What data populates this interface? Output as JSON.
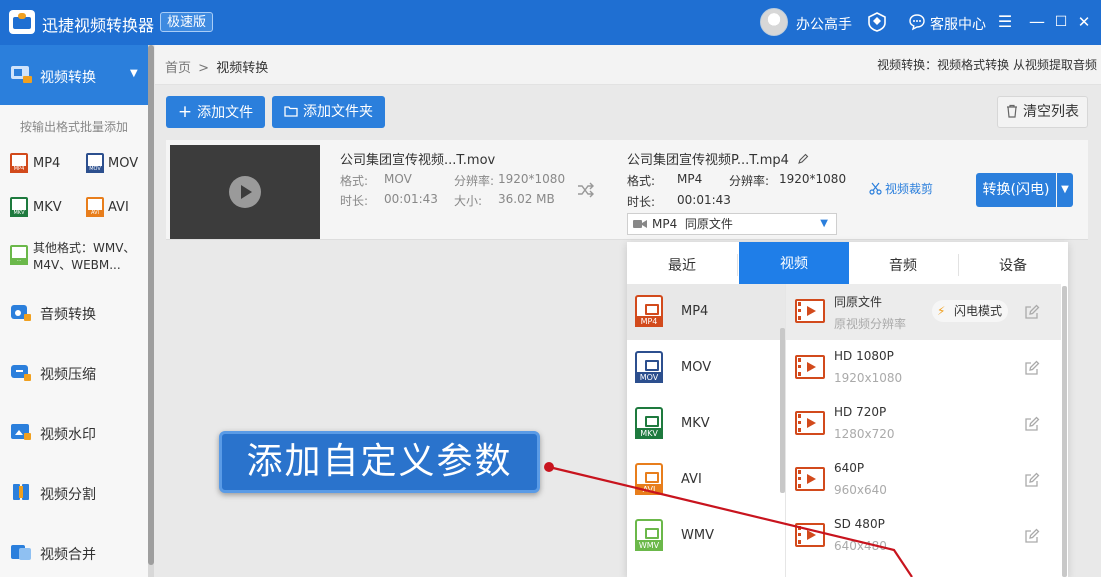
{
  "titlebar": {
    "app_title": "迅捷视频转换器",
    "edition_badge": "极速版",
    "user_name": "办公高手",
    "service_label": "客服中心",
    "menu_glyph": "☰",
    "minimize_glyph": "—",
    "maximize_glyph": "☐",
    "close_glyph": "✕"
  },
  "sidebar": {
    "active_item": "视频转换",
    "batch_hint": "按输出格式批量添加",
    "formats": [
      {
        "label": "MP4",
        "color": "#d24a1c"
      },
      {
        "label": "MOV",
        "color": "#2c4f8e"
      },
      {
        "label": "MKV",
        "color": "#1e7a3e"
      },
      {
        "label": "AVI",
        "color": "#e87e1c"
      }
    ],
    "other_formats_line1": "其他格式：WMV、",
    "other_formats_line2": "M4V、WEBM...",
    "items": [
      {
        "label": "音频转换"
      },
      {
        "label": "视频压缩"
      },
      {
        "label": "视频水印"
      },
      {
        "label": "视频分割"
      },
      {
        "label": "视频合并"
      }
    ]
  },
  "breadcrumb": {
    "home": "首页",
    "separator": ">",
    "current": "视频转换",
    "right_info": "视频转换：视频格式转换 从视频提取音频"
  },
  "toolbar": {
    "add_file": "添加文件",
    "add_folder": "添加文件夹",
    "clear_list": "清空列表"
  },
  "file": {
    "source_name": "公司集团宣传视频...T.mov",
    "source_format_label": "格式:",
    "source_format": "MOV",
    "source_resolution_label": "分辨率:",
    "source_resolution": "1920*1080",
    "source_duration_label": "时长:",
    "source_duration": "00:01:43",
    "source_size_label": "大小:",
    "source_size": "36.02 MB",
    "output_name": "公司集团宣传视频P...T.mp4",
    "output_format_label": "格式:",
    "output_format": "MP4",
    "output_resolution_label": "分辨率:",
    "output_resolution": "1920*1080",
    "output_duration_label": "时长:",
    "output_duration": "00:01:43",
    "output_selector": "MP4  同原文件",
    "crop_label": "视频裁剪",
    "convert_label": "转换(闪电)"
  },
  "format_panel": {
    "tabs": [
      {
        "label": "最近"
      },
      {
        "label": "视频"
      },
      {
        "label": "音频"
      },
      {
        "label": "设备"
      }
    ],
    "active_tab": "视频",
    "format_list": [
      {
        "label": "MP4",
        "badge": "MP4",
        "color": "#d24a1c"
      },
      {
        "label": "MOV",
        "badge": "MOV",
        "color": "#2c4f8e"
      },
      {
        "label": "MKV",
        "badge": "MKV",
        "color": "#1e7a3e"
      },
      {
        "label": "AVI",
        "badge": "AVI",
        "color": "#e87e1c"
      },
      {
        "label": "WMV",
        "badge": "WMV",
        "color": "#6bb84a"
      }
    ],
    "presets": [
      {
        "name": "同原文件",
        "sub": "原视频分辨率"
      },
      {
        "name": "HD 1080P",
        "sub": "1920x1080"
      },
      {
        "name": "HD 720P",
        "sub": "1280x720"
      },
      {
        "name": "640P",
        "sub": "960x640"
      },
      {
        "name": "SD 480P",
        "sub": "640x480"
      }
    ],
    "flash_mode": "闪电模式"
  },
  "annotation": {
    "callout_text": "添加自定义参数",
    "line_color": "#c8141e"
  },
  "colors": {
    "accent": "#1f6fd2",
    "button": "#2b7fdc"
  }
}
